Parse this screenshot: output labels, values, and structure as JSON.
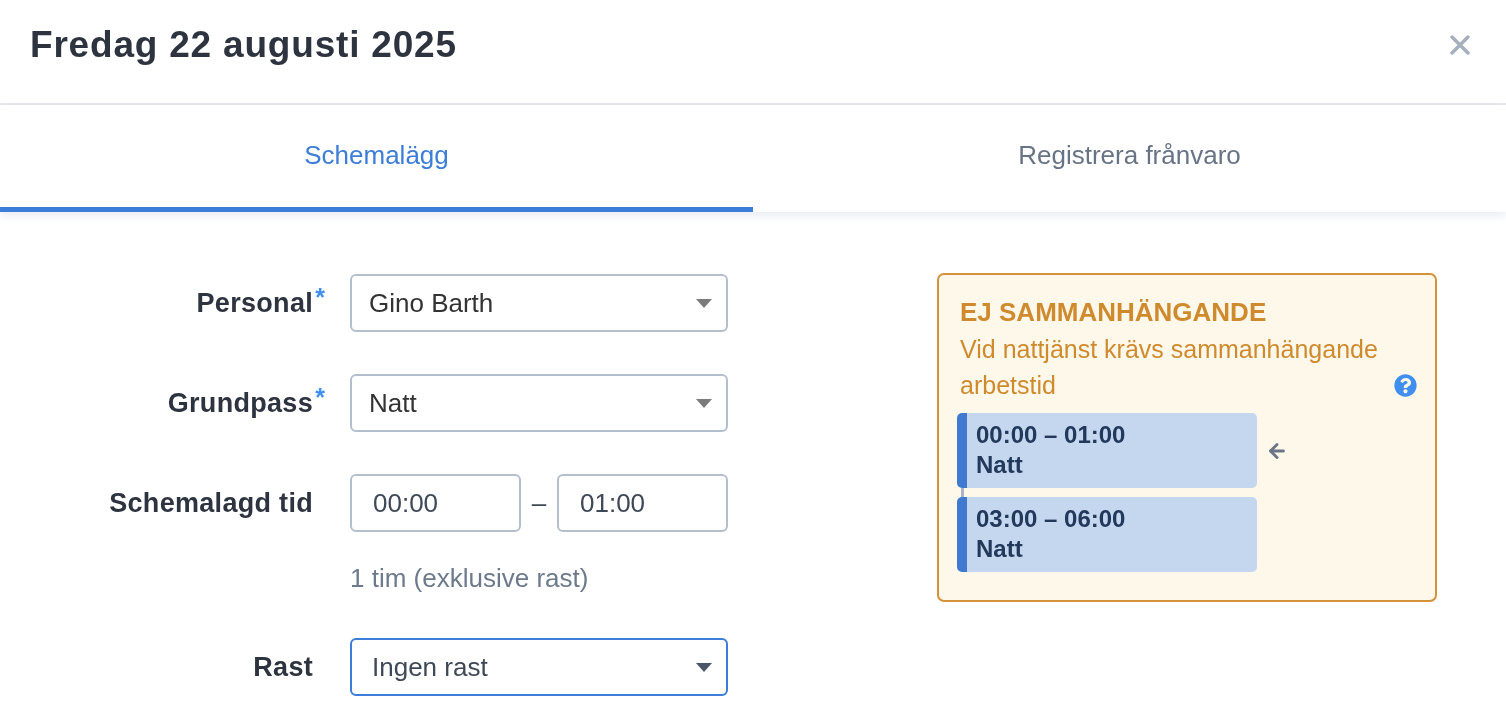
{
  "dialog": {
    "title": "Fredag 22 augusti 2025"
  },
  "tabs": [
    {
      "label": "Schemalägg",
      "selected": true
    },
    {
      "label": "Registrera frånvaro",
      "selected": false
    }
  ],
  "form": {
    "fields": [
      {
        "kind": "select",
        "label": "Personal",
        "required_mark": "*",
        "value": "Gino Barth",
        "focused": false
      },
      {
        "kind": "select",
        "label": "Grundpass",
        "required_mark": "*",
        "value": "Natt",
        "focused": false
      },
      {
        "kind": "time_range",
        "label": "Schemalagd tid",
        "start": "00:00",
        "separator": "–",
        "end": "01:00",
        "hint": "1 tim (exklusive rast)"
      },
      {
        "kind": "select",
        "label": "Rast",
        "value": "Ingen rast",
        "focused": true
      }
    ]
  },
  "warning": {
    "title": "EJ SAMMANHÄNGANDE",
    "message": "Vid nattjänst krävs sammanhängande arbetstid",
    "shifts": [
      {
        "time": "00:00 – 01:00",
        "name": "Natt",
        "selected": true
      },
      {
        "time": "03:00 – 06:00",
        "name": "Natt",
        "selected": false
      }
    ]
  }
}
